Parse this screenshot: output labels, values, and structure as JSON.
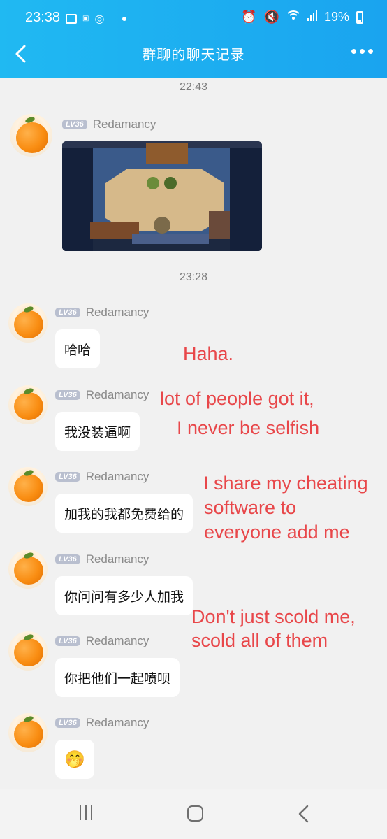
{
  "status_bar": {
    "time": "23:38",
    "left_icons": [
      "image-icon",
      "app-icon",
      "netease-music-icon",
      "dot-icon"
    ],
    "right_icons": [
      "alarm-icon",
      "mute-icon",
      "wifi-icon",
      "signal-icon"
    ],
    "battery": "19%"
  },
  "nav": {
    "title": "群聊的聊天记录",
    "back_icon": "back-arrow-icon",
    "more_icon": "more-icon"
  },
  "timestamps": [
    "22:43",
    "23:28"
  ],
  "messages": [
    {
      "level": "LV36",
      "sender": "Redamancy",
      "type": "image",
      "image_desc": "hearthstone-game-screenshot"
    },
    {
      "level": "LV36",
      "sender": "Redamancy",
      "text": "哈哈"
    },
    {
      "level": "LV36",
      "sender": "Redamancy",
      "text": "我没装逼啊"
    },
    {
      "level": "LV36",
      "sender": "Redamancy",
      "text": "加我的我都免费给的"
    },
    {
      "level": "LV36",
      "sender": "Redamancy",
      "text": "你问问有多少人加我"
    },
    {
      "level": "LV36",
      "sender": "Redamancy",
      "text": "你把他们一起喷呗"
    },
    {
      "level": "LV36",
      "sender": "Redamancy",
      "text": "🤭",
      "type": "emoji"
    }
  ],
  "annotations": [
    "Haha.",
    "lot of people got it,",
    "I never be selfish",
    "I share my cheating",
    "software to",
    "everyone add me",
    "Don't just scold me,",
    "scold all of them"
  ],
  "colors": {
    "header_start": "#20b9f2",
    "header_end": "#1aa4ef",
    "annotation": "#e8474a",
    "background": "#f1f1f1",
    "level_badge": "#b9bfcf"
  },
  "bottom_nav": {
    "icons": [
      "recents-icon",
      "home-icon",
      "back-icon"
    ]
  }
}
